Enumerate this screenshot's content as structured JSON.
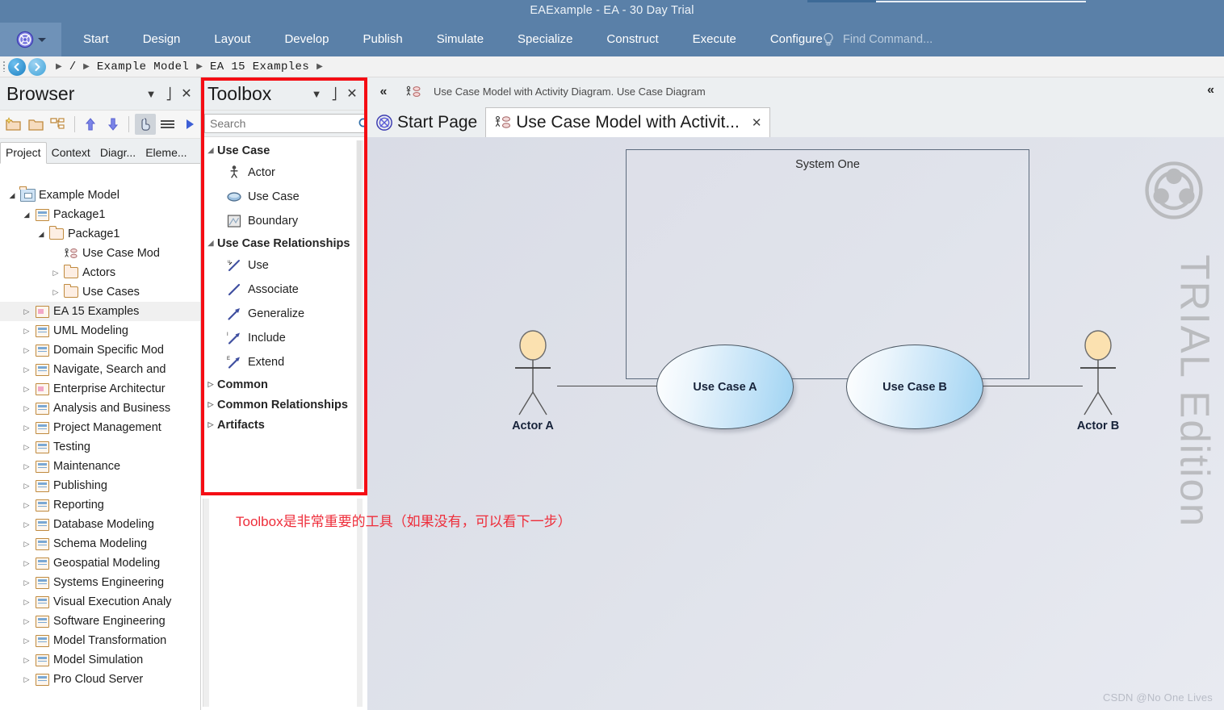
{
  "window": {
    "title": "EAExample - EA - 30 Day Trial"
  },
  "ribbon": {
    "logo_icon": "ea-logo-icon",
    "tabs": [
      "Start",
      "Design",
      "Layout",
      "Develop",
      "Publish",
      "Simulate",
      "Specialize",
      "Construct",
      "Execute",
      "Configure"
    ],
    "find_command": {
      "icon": "lightbulb-icon",
      "placeholder": "Find Command..."
    }
  },
  "breadcrumb": {
    "back_icon": "arrow-left-icon",
    "forward_icon": "arrow-right-icon",
    "root": "/",
    "items": [
      "Example Model",
      "EA 15 Examples"
    ]
  },
  "browser": {
    "title": "Browser",
    "header_buttons": [
      {
        "name": "dropdown",
        "glyph": "▼"
      },
      {
        "name": "pin",
        "glyph": "⚐"
      },
      {
        "name": "close",
        "glyph": "✕"
      }
    ],
    "toolbar": [
      {
        "name": "new-package-icon",
        "label": "New Package"
      },
      {
        "name": "folder-icon",
        "label": "Folder"
      },
      {
        "name": "hierarchy-icon",
        "label": "Hierarchy"
      },
      {
        "name": "move-up-icon",
        "label": "Move Up"
      },
      {
        "name": "move-down-icon",
        "label": "Move Down"
      },
      {
        "name": "select-pointer-icon",
        "label": "Select"
      },
      {
        "name": "list-menu-icon",
        "label": "Menu"
      },
      {
        "name": "play-icon",
        "label": "Run"
      }
    ],
    "tabs": [
      {
        "label": "Project",
        "selected": true
      },
      {
        "label": "Context",
        "selected": false
      },
      {
        "label": "Diagr...",
        "selected": false
      },
      {
        "label": "Eleme...",
        "selected": false
      }
    ],
    "tree": [
      {
        "label": "Example Model",
        "indent": 0,
        "expander": "open",
        "icon": "model-icon",
        "selected": false
      },
      {
        "label": "Package1",
        "indent": 1,
        "expander": "open",
        "icon": "view-blue-icon",
        "selected": false
      },
      {
        "label": "Package1",
        "indent": 2,
        "expander": "open",
        "icon": "folder-icon",
        "selected": false
      },
      {
        "label": "Use Case Mod",
        "indent": 3,
        "expander": "none",
        "icon": "usecase-diagram-icon",
        "selected": false
      },
      {
        "label": "Actors",
        "indent": 3,
        "expander": "closed",
        "icon": "folder-icon",
        "selected": false
      },
      {
        "label": "Use Cases",
        "indent": 3,
        "expander": "closed",
        "icon": "folder-icon",
        "selected": false
      },
      {
        "label": "EA 15 Examples",
        "indent": 1,
        "expander": "closed",
        "icon": "view-pink-icon",
        "selected": true
      },
      {
        "label": "UML Modeling",
        "indent": 1,
        "expander": "closed",
        "icon": "view-blue-icon",
        "selected": false
      },
      {
        "label": "Domain Specific Mod",
        "indent": 1,
        "expander": "closed",
        "icon": "view-blue-icon",
        "selected": false
      },
      {
        "label": "Navigate, Search and",
        "indent": 1,
        "expander": "closed",
        "icon": "view-blue-icon",
        "selected": false
      },
      {
        "label": "Enterprise Architectur",
        "indent": 1,
        "expander": "closed",
        "icon": "view-pink-icon",
        "selected": false
      },
      {
        "label": "Analysis and Business",
        "indent": 1,
        "expander": "closed",
        "icon": "view-blue-icon",
        "selected": false
      },
      {
        "label": "Project Management",
        "indent": 1,
        "expander": "closed",
        "icon": "view-blue-icon",
        "selected": false
      },
      {
        "label": "Testing",
        "indent": 1,
        "expander": "closed",
        "icon": "view-blue-icon",
        "selected": false
      },
      {
        "label": "Maintenance",
        "indent": 1,
        "expander": "closed",
        "icon": "view-blue-icon",
        "selected": false
      },
      {
        "label": "Publishing",
        "indent": 1,
        "expander": "closed",
        "icon": "view-blue-icon",
        "selected": false
      },
      {
        "label": "Reporting",
        "indent": 1,
        "expander": "closed",
        "icon": "view-blue-icon",
        "selected": false
      },
      {
        "label": "Database Modeling",
        "indent": 1,
        "expander": "closed",
        "icon": "view-blue-icon",
        "selected": false
      },
      {
        "label": "Schema Modeling",
        "indent": 1,
        "expander": "closed",
        "icon": "view-blue-icon",
        "selected": false
      },
      {
        "label": "Geospatial Modeling",
        "indent": 1,
        "expander": "closed",
        "icon": "view-blue-icon",
        "selected": false
      },
      {
        "label": "Systems Engineering",
        "indent": 1,
        "expander": "closed",
        "icon": "view-blue-icon",
        "selected": false
      },
      {
        "label": "Visual Execution Analy",
        "indent": 1,
        "expander": "closed",
        "icon": "view-blue-icon",
        "selected": false
      },
      {
        "label": "Software Engineering",
        "indent": 1,
        "expander": "closed",
        "icon": "view-blue-icon",
        "selected": false
      },
      {
        "label": "Model Transformation",
        "indent": 1,
        "expander": "closed",
        "icon": "view-blue-icon",
        "selected": false
      },
      {
        "label": "Model Simulation",
        "indent": 1,
        "expander": "closed",
        "icon": "view-blue-icon",
        "selected": false
      },
      {
        "label": "Pro Cloud Server",
        "indent": 1,
        "expander": "closed",
        "icon": "view-blue-icon",
        "selected": false
      }
    ]
  },
  "toolbox": {
    "title": "Toolbox",
    "search_placeholder": "Search",
    "search_value": "",
    "search_icon": "magnifier-icon",
    "find_icon": "magnifier-icon",
    "menu_icon": "hamburger-icon",
    "groups": [
      {
        "label": "Use Case",
        "expanded": true,
        "items": [
          {
            "label": "Actor",
            "icon": "actor-icon"
          },
          {
            "label": "Use Case",
            "icon": "ellipse-usecase-icon"
          },
          {
            "label": "Boundary",
            "icon": "boundary-icon"
          }
        ]
      },
      {
        "label": "Use Case Relationships",
        "expanded": true,
        "items": [
          {
            "label": "Use",
            "icon": "use-arrow-icon"
          },
          {
            "label": "Associate",
            "icon": "associate-line-icon"
          },
          {
            "label": "Generalize",
            "icon": "generalize-arrow-icon"
          },
          {
            "label": "Include",
            "icon": "include-arrow-icon"
          },
          {
            "label": "Extend",
            "icon": "extend-arrow-icon"
          }
        ]
      },
      {
        "label": "Common",
        "expanded": false,
        "items": []
      },
      {
        "label": "Common Relationships",
        "expanded": false,
        "items": []
      },
      {
        "label": "Artifacts",
        "expanded": false,
        "items": []
      }
    ]
  },
  "diagram_area": {
    "collapse_left_icon": "chevron-double-left-icon",
    "collapse_right_icon": "chevron-double-left-icon",
    "caption_icon": "usecase-diagram-icon",
    "caption": "Use Case Model with Activity Diagram.  Use Case Diagram",
    "tabs": [
      {
        "label": "Start Page",
        "icon": "ea-logo-icon",
        "selected": false,
        "closable": false
      },
      {
        "label": "Use Case Model with Activit...",
        "icon": "usecase-diagram-icon",
        "selected": true,
        "closable": true,
        "close_glyph": "✕"
      }
    ],
    "watermark": {
      "text": "TRIAL Edition",
      "logo_icon": "ea-logo-watermark-icon"
    },
    "diagram": {
      "system_label": "System One",
      "use_cases": [
        {
          "label": "Use Case A"
        },
        {
          "label": "Use Case B"
        }
      ],
      "actors": [
        {
          "label": "Actor A"
        },
        {
          "label": "Actor B"
        }
      ]
    }
  },
  "annotation": {
    "text": "Toolbox是非常重要的工具（如果没有，可以看下一步）",
    "color": "#ee2d3a"
  },
  "credit": {
    "text": "CSDN @No One Lives"
  },
  "colors": {
    "titlebar": "#5a80a8",
    "ribbon": "#5a80a8",
    "panel_header": "#eceff1",
    "canvas": "#dde0e9",
    "highlight_box": "#f50d14",
    "usecase_fill": "#9ed3f2",
    "actor_head": "#fbe1b0"
  }
}
